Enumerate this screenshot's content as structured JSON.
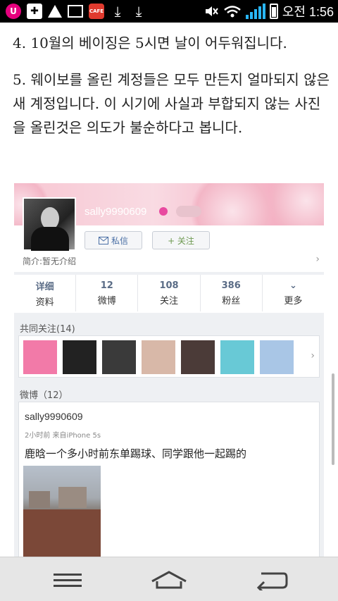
{
  "status_bar": {
    "time": "오전 1:56",
    "icons": [
      "u-plus-icon",
      "plus-box-icon",
      "warning-icon",
      "image-icon",
      "cafe-app-icon",
      "download-icon",
      "download-icon",
      "mute-icon",
      "wifi-icon",
      "signal-icon",
      "battery-icon"
    ],
    "u_label": "U",
    "cafe_label": "CAFE"
  },
  "article": {
    "paragraph1": "4. 10월의 베이징은 5시면 날이 어두워집니다.",
    "paragraph2": "5. 웨이보를 올린 계정들은 모두 만든지 얼마되지 않은 새 계정입니다. 이 시기에 사실과 부합되지 않는 사진을 올린것은 의도가 불순하다고 봅니다."
  },
  "weibo_profile": {
    "username": "sally9990609",
    "buttons": {
      "message_label": "私信",
      "follow_label": "+ 关注"
    },
    "intro": "简介:暂无介绍",
    "stats": [
      {
        "top": "详细",
        "bottom": "资料"
      },
      {
        "top": "12",
        "bottom": "微博"
      },
      {
        "top": "108",
        "bottom": "关注"
      },
      {
        "top": "386",
        "bottom": "粉丝"
      },
      {
        "top": "⌄",
        "bottom": "更多"
      }
    ],
    "common_follow_title": "共同关注(14)",
    "weibo_title": "微博（12）",
    "post": {
      "user": "sally9990609",
      "meta": "2小时前  来自iPhone 5s",
      "text": "鹿晗一个多小时前东单踢球、同学跟他一起踢的"
    }
  },
  "nav_bar": {
    "icons": [
      "menu-icon",
      "home-icon",
      "back-icon"
    ]
  },
  "colors": {
    "status_bg": "#000000",
    "banner_pink": "#f7c6d2",
    "stat_blue": "#5a6c86",
    "nav_bg": "#e6e6e6"
  }
}
